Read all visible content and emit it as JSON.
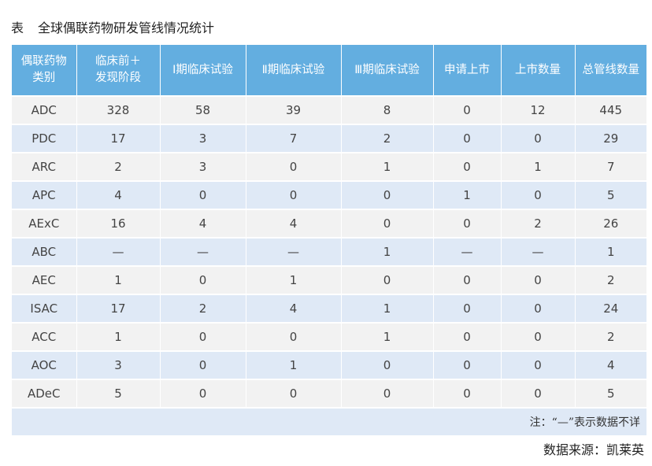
{
  "title": {
    "prefix": "表",
    "text": "全球偶联药物研发管线情况统计"
  },
  "headers": [
    "偶联药物\n类别",
    "临床前＋\n发现阶段",
    "Ⅰ期临床试验",
    "Ⅱ期临床试验",
    "Ⅲ期临床试验",
    "申请上市",
    "上市数量",
    "总管线数量"
  ],
  "rows": [
    [
      "ADC",
      "328",
      "58",
      "39",
      "8",
      "0",
      "12",
      "445"
    ],
    [
      "PDC",
      "17",
      "3",
      "7",
      "2",
      "0",
      "0",
      "29"
    ],
    [
      "ARC",
      "2",
      "3",
      "0",
      "1",
      "0",
      "1",
      "7"
    ],
    [
      "APC",
      "4",
      "0",
      "0",
      "0",
      "1",
      "0",
      "5"
    ],
    [
      "AExC",
      "16",
      "4",
      "4",
      "0",
      "0",
      "2",
      "26"
    ],
    [
      "ABC",
      "—",
      "—",
      "—",
      "1",
      "—",
      "—",
      "1"
    ],
    [
      "AEC",
      "1",
      "0",
      "1",
      "0",
      "0",
      "0",
      "2"
    ],
    [
      "ISAC",
      "17",
      "2",
      "4",
      "1",
      "0",
      "0",
      "24"
    ],
    [
      "ACC",
      "1",
      "0",
      "0",
      "1",
      "0",
      "0",
      "2"
    ],
    [
      "AOC",
      "3",
      "0",
      "1",
      "0",
      "0",
      "0",
      "4"
    ],
    [
      "ADeC",
      "5",
      "0",
      "0",
      "0",
      "0",
      "0",
      "5"
    ]
  ],
  "note": "注：“—”表示数据不详",
  "source": "数据来源：凯莱英",
  "colors": {
    "header_bg": "#63aee0",
    "row_odd": "#f2f2f2",
    "row_even": "#dfe9f6"
  }
}
